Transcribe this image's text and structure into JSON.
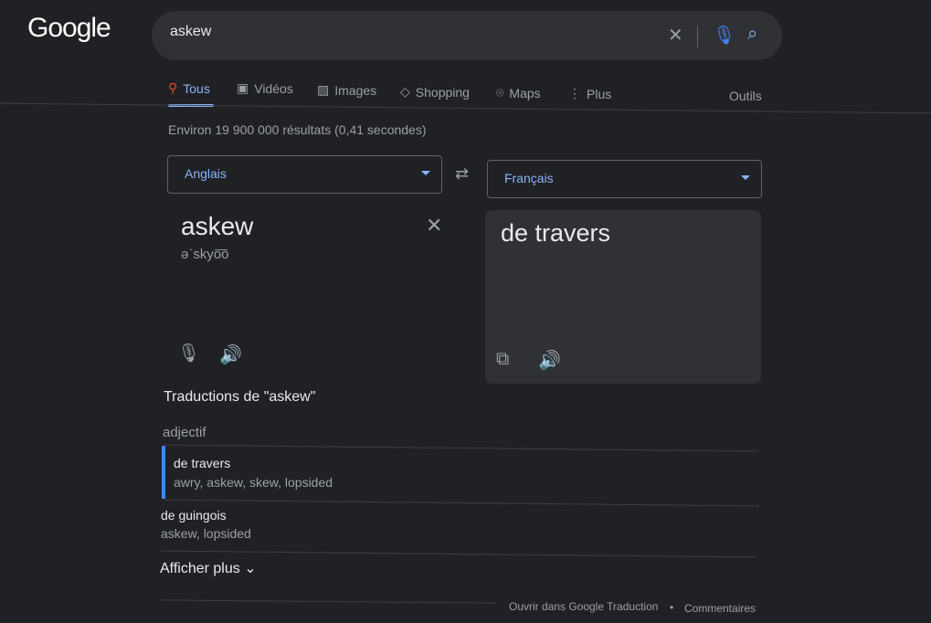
{
  "logo": "Google",
  "search": {
    "query": "askew",
    "clear_icon": "close-icon",
    "mic_icon": "mic-icon",
    "search_icon": "search-icon"
  },
  "tabs": [
    {
      "label": "Tous",
      "icon": "search-icon",
      "active": true
    },
    {
      "label": "Vidéos",
      "icon": "play-icon"
    },
    {
      "label": "Images",
      "icon": "image-icon"
    },
    {
      "label": "Shopping",
      "icon": "tag-icon"
    },
    {
      "label": "Maps",
      "icon": "pin-icon"
    },
    {
      "label": "Plus",
      "icon": "more-vert-icon"
    }
  ],
  "tools": "Outils",
  "stats": "Environ 19 900 000 résultats (0,41 secondes)",
  "translate": {
    "source_lang": "Anglais",
    "target_lang": "Français",
    "source_text": "askew",
    "phonetic": "əˈskyo͞o",
    "target_text": "de travers",
    "heading": "Traductions de \"askew\"",
    "pos": "adjectif",
    "entries": [
      {
        "word": "de travers",
        "synonyms": "awry, askew, skew, lopsided",
        "highlighted": true
      },
      {
        "word": "de guingois",
        "synonyms": "askew, lopsided"
      }
    ],
    "show_more": "Afficher plus",
    "open_link": "Ouvrir dans Google Traduction",
    "separator": "•",
    "feedback": "Commentaires"
  },
  "colors": {
    "bg": "#202124",
    "accent": "#8ab4f8",
    "highlight": "#4285f4"
  }
}
